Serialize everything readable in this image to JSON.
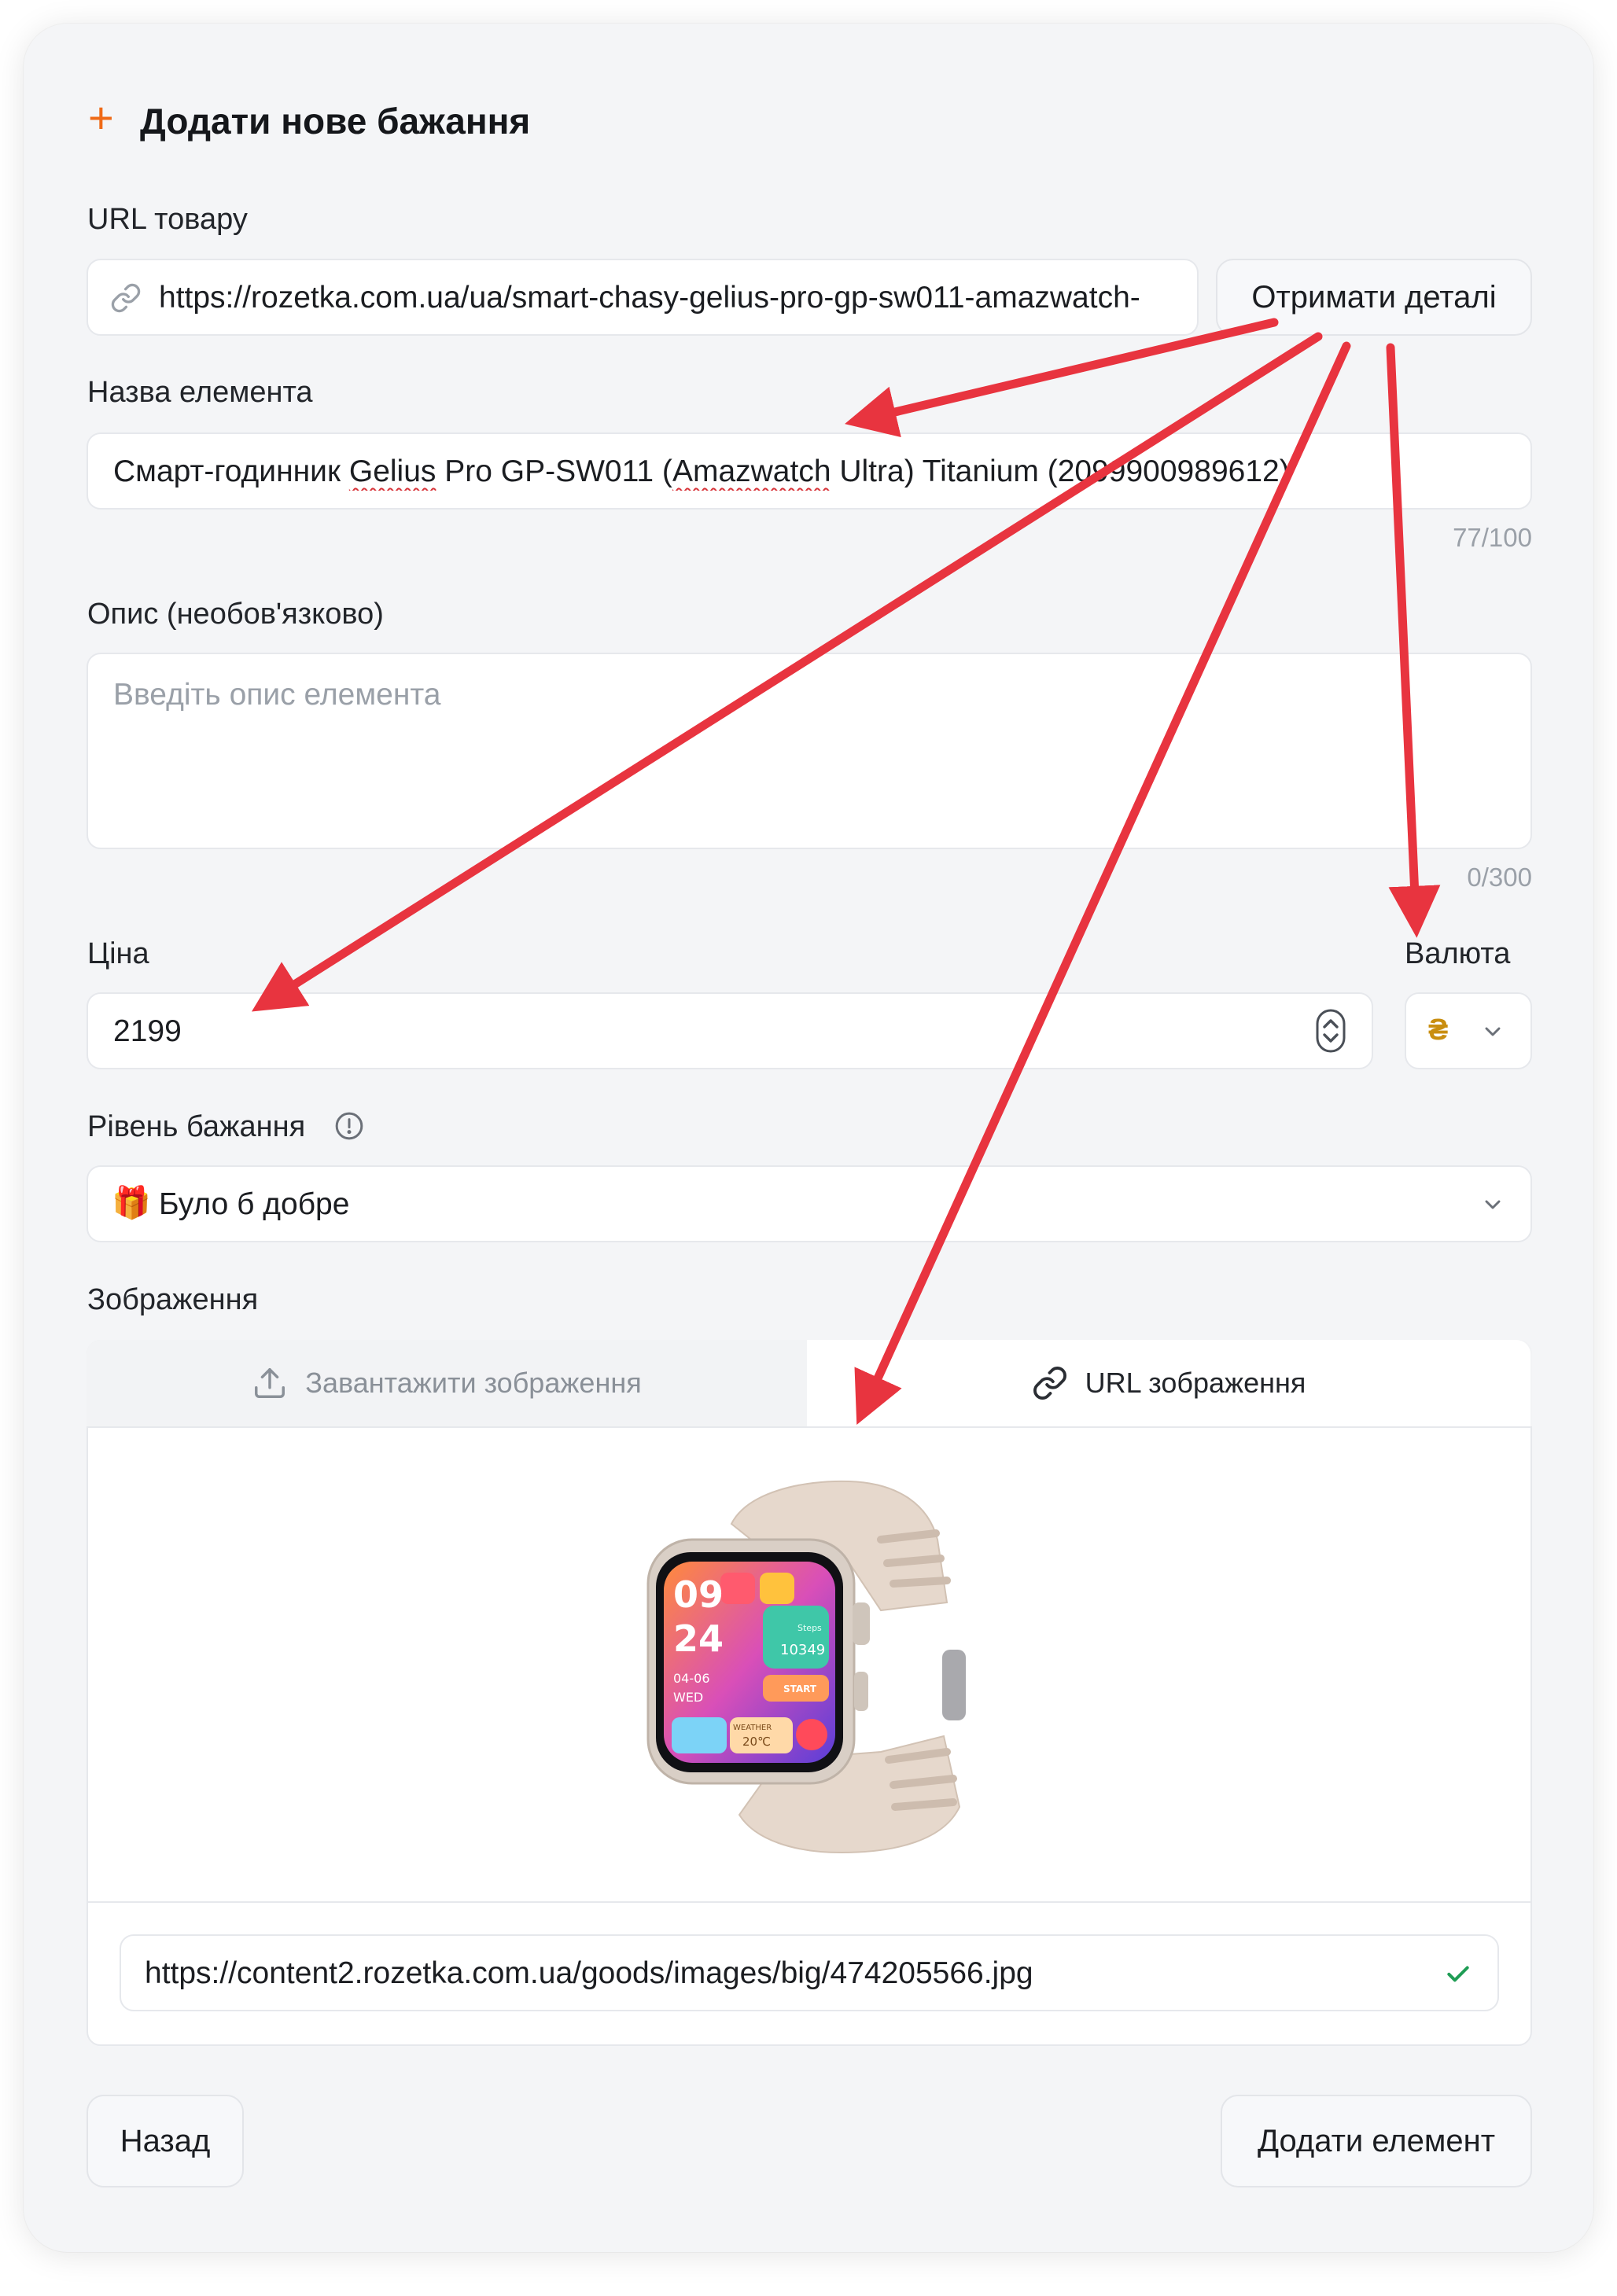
{
  "form": {
    "title": "Додати нове бажання",
    "url_section": {
      "label": "URL товару",
      "value": "https://rozetka.com.ua/ua/smart-chasy-gelius-pro-gp-sw011-amazwatch-",
      "fetch_button": "Отримати деталі"
    },
    "name_section": {
      "label": "Назва елемента",
      "value_prefix": "Смарт-годинник ",
      "value_gelius": "Gelius",
      "value_mid": " Pro GP-SW011 (",
      "value_amazwatch": "Amazwatch",
      "value_suffix": " Ultra) Titanium (2099900989612)",
      "counter": "77/100"
    },
    "description_section": {
      "label": "Опис (необов'язково)",
      "placeholder": "Введіть опис елемента",
      "counter": "0/300"
    },
    "price_section": {
      "label": "Ціна",
      "value": "2199"
    },
    "currency_section": {
      "label": "Валюта",
      "value": "₴"
    },
    "desire_section": {
      "label": "Рівень бажання",
      "emoji": "🎁",
      "value": "Було б добре"
    },
    "image_section": {
      "label": "Зображення",
      "tab_upload": "Завантажити зображення",
      "tab_url": "URL зображення",
      "active_tab": "URL зображення",
      "image_url": "https://content2.rozetka.com.ua/goods/images/big/474205566.jpg",
      "watch_face": {
        "hour": "09",
        "minute": "24",
        "date": "04-06",
        "day": "WED",
        "steps_label": "Steps",
        "steps": "10349",
        "start": "START",
        "weather_label": "WEATHER",
        "temperature": "20℃"
      }
    },
    "footer": {
      "back_button": "Назад",
      "add_button": "Додати елемент"
    }
  },
  "colors": {
    "accent": "#ef6a17",
    "annotation_arrow": "#e8343f",
    "success_check": "#1f9d55",
    "currency_symbol": "#c98e10"
  }
}
